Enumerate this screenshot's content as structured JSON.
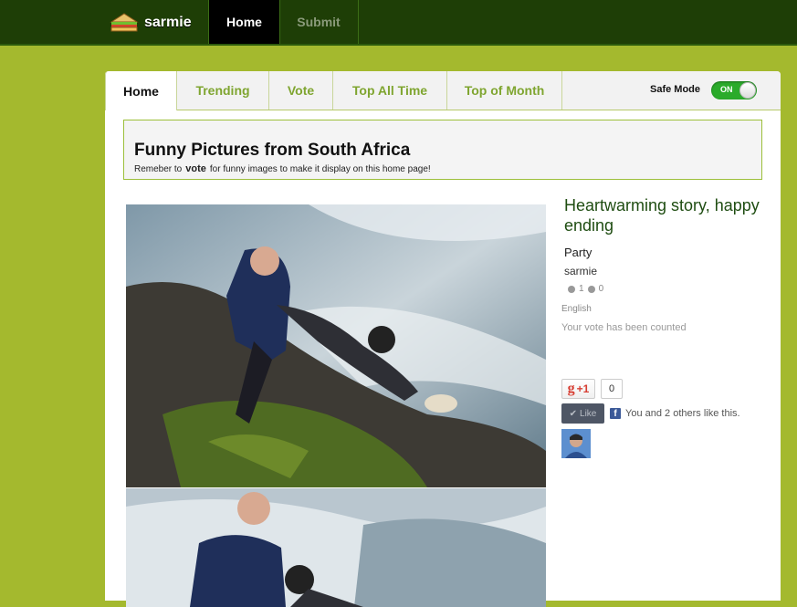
{
  "header": {
    "logo_text": "sarmie",
    "nav": {
      "home": "Home",
      "submit": "Submit"
    }
  },
  "tabs": [
    {
      "label": "Home"
    },
    {
      "label": "Trending"
    },
    {
      "label": "Vote"
    },
    {
      "label": "Top All Time"
    },
    {
      "label": "Top of Month"
    }
  ],
  "safe_mode": {
    "label": "Safe Mode",
    "state": "ON"
  },
  "banner": {
    "title": "Funny Pictures from South Africa",
    "subtitle_pre": "Remeber to",
    "subtitle_link": "vote",
    "subtitle_post": "for funny images to make it display on this home page!"
  },
  "post": {
    "title": "Heartwarming story, happy ending",
    "category": "Party",
    "author": "sarmie",
    "likes": "1",
    "dislikes": "0",
    "language": "English",
    "vote_message": "Your vote has been counted"
  },
  "social": {
    "gplus_label": "+1",
    "gplus_count": "0",
    "fb_like_label": "Like",
    "fb_text": "You and 2 others like this."
  },
  "colors": {
    "background": "#a4b92e",
    "topbar": "#1e3e06",
    "accent_green": "#7fa530",
    "toggle_on": "#2bab2b"
  }
}
